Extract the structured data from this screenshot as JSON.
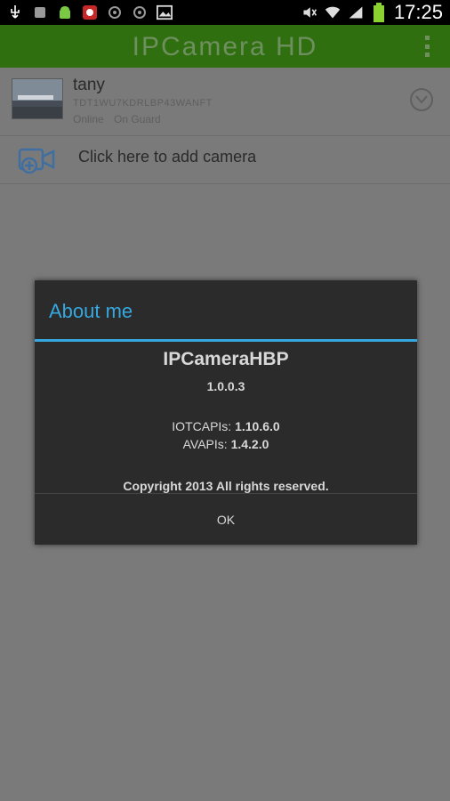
{
  "status_bar": {
    "left_icons": [
      "usb-icon",
      "notification-icon",
      "android-icon",
      "app-icon",
      "settings-icon",
      "theme-icon",
      "gallery-icon"
    ],
    "right_icons": [
      "mute-icon",
      "wifi-icon",
      "signal-icon",
      "battery-icon"
    ],
    "time": "17:25"
  },
  "action_bar": {
    "title": "IPCamera HD",
    "overflow_icon": "overflow-menu-icon"
  },
  "camera_list": {
    "items": [
      {
        "name": "tany",
        "uid": "TDT1WU7KDRLBP43WANFT",
        "status": "Online",
        "mode": "On Guard",
        "action_icon": "chevron-down-circle-icon"
      }
    ],
    "add_label": "Click here to add camera"
  },
  "dialog": {
    "title": "About me",
    "app_name": "IPCameraHBP",
    "version": "1.0.0.3",
    "iotc_label": "IOTCAPIs:",
    "iotc_value": "1.10.6.0",
    "av_label": "AVAPIs:",
    "av_value": "1.4.2.0",
    "copyright": "Copyright 2013 All rights reserved.",
    "ok_label": "OK"
  },
  "colors": {
    "accent": "#36a7df",
    "action_bar": "#2f6f0f",
    "dialog_bg": "#2b2b2b"
  }
}
